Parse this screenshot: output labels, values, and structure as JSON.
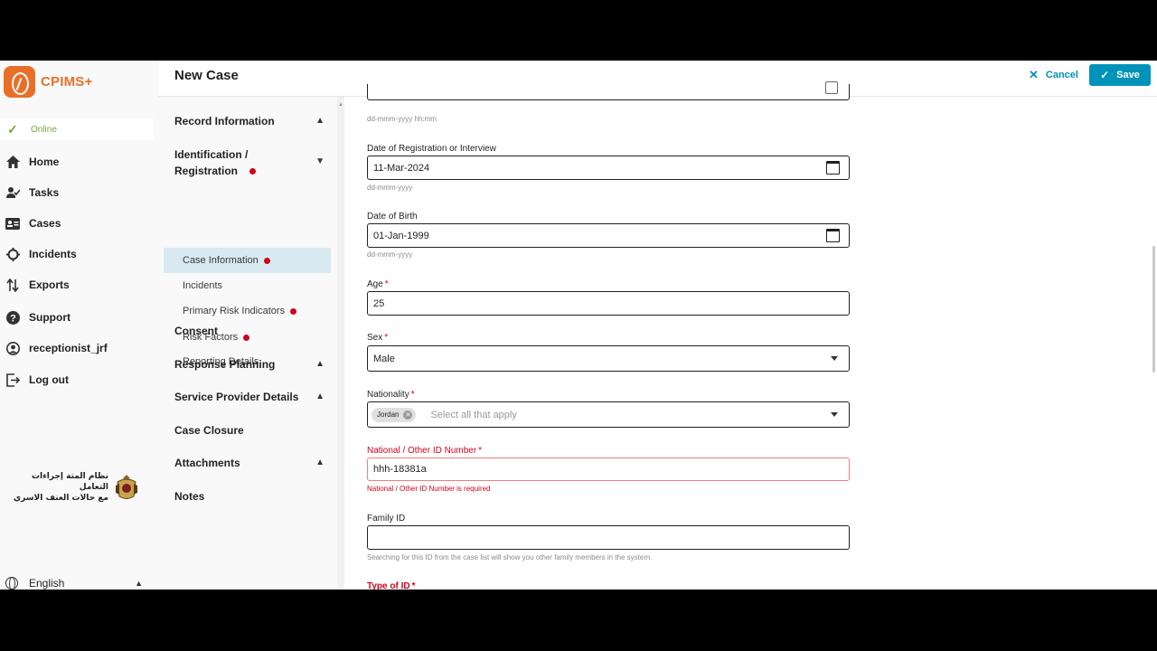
{
  "app": {
    "name": "CPIMS+",
    "brand_color": "#e96f29",
    "accent_color": "#0093ba"
  },
  "status": {
    "label": "Online"
  },
  "nav": [
    {
      "label": "Home",
      "icon": "home-icon"
    },
    {
      "label": "Tasks",
      "icon": "tasks-icon"
    },
    {
      "label": "Cases",
      "icon": "cases-icon"
    },
    {
      "label": "Incidents",
      "icon": "incidents-icon"
    },
    {
      "label": "Exports",
      "icon": "exports-icon"
    },
    {
      "label": "Support",
      "icon": "help-icon"
    },
    {
      "label": "receptionist_jrf",
      "icon": "user-icon"
    },
    {
      "label": "Log out",
      "icon": "logout-icon"
    }
  ],
  "emblem": {
    "text_line1": "نظام المتة إجراءات التعامل",
    "text_line2": "مع حالات العنف الاسري"
  },
  "language": {
    "label": "English"
  },
  "header": {
    "title": "New Case",
    "cancel_label": "Cancel",
    "save_label": "Save"
  },
  "form_nav": {
    "record_information": "Record Information",
    "identification": "Identification / Registration",
    "subsections": [
      {
        "label": "Case Information",
        "error": true
      },
      {
        "label": "Incidents",
        "error": false
      },
      {
        "label": "Primary Risk Indicators",
        "error": true
      },
      {
        "label": "Risk Factors",
        "error": true
      },
      {
        "label": "Reporting Details",
        "error": false
      }
    ],
    "consent": "Consent",
    "response_planning": "Response Planning",
    "service_provider_details": "Service Provider Details",
    "case_closure": "Case Closure",
    "attachments": "Attachments",
    "notes": "Notes"
  },
  "form": {
    "top_help": "dd-mmm-yyyy hh:mm",
    "registration_date": {
      "label": "Date of Registration or Interview",
      "value": "11-Mar-2024",
      "help": "dd-mmm-yyyy"
    },
    "dob": {
      "label": "Date of Birth",
      "value": "01-Jan-1999",
      "help": "dd-mmm-yyyy"
    },
    "age": {
      "label": "Age",
      "value": "25"
    },
    "sex": {
      "label": "Sex",
      "value": "Male"
    },
    "nationality": {
      "label": "Nationality",
      "chip": "Jordan",
      "placeholder": "Select all that apply"
    },
    "national_id": {
      "label": "National / Other ID Number",
      "value": "hhh-18381a",
      "error": "National / Other ID Number is required"
    },
    "family_id": {
      "label": "Family ID",
      "value": "",
      "help": "Searching for this ID from the case list will show you other family members in the system."
    },
    "type_of_id": {
      "label": "Type of ID"
    },
    "required_mark": "*"
  }
}
